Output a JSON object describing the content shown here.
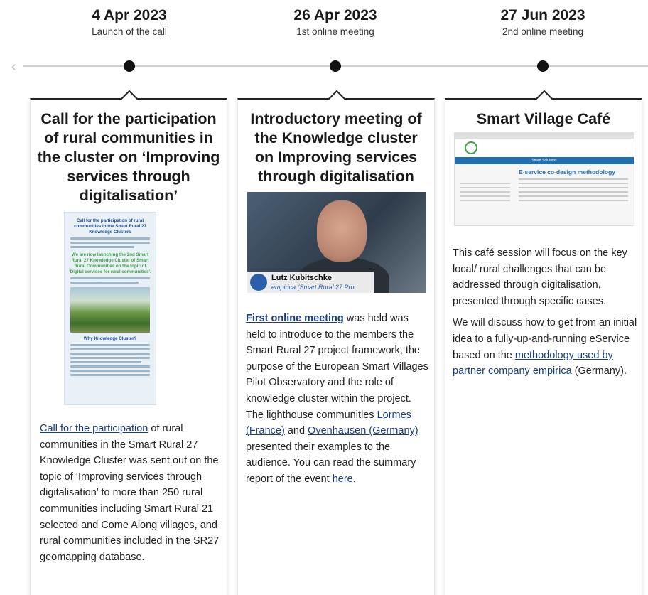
{
  "timeline": {
    "events": [
      {
        "date": "4 Apr 2023",
        "subtitle": "Launch of the call"
      },
      {
        "date": "26 Apr 2023",
        "subtitle": "1st online meeting"
      },
      {
        "date": "27 Jun 2023",
        "subtitle": "2nd online meeting"
      }
    ]
  },
  "cards": {
    "c1": {
      "title": "Call for the participation of rural communities in the cluster on ‘Improving services through digitalisation’",
      "poster": {
        "heading": "Call for the participation of rural communities in the Smart Rural 27 Knowledge Clusters",
        "subheading": "We are now launching the 2nd Smart Rural 27 Knowledge Cluster of Smart Rural Communities on the topic of 'Digital services for rural communities'.",
        "section": "Why Knowledge Cluster?"
      },
      "link": "Call for the participation",
      "text": " of rural communities in the Smart Rural 27 Knowledge Cluster was sent out on the topic of ‘Improving services through digitalisation’ to more than 250 rural communities including Smart Rural 21 selected and Come Along villages, and rural communities included in the SR27 geomapping database."
    },
    "c2": {
      "title": "Introductory meeting of the Knowledge cluster on Improving services through digitalisation",
      "video": {
        "name": "Lutz Kubitschke",
        "org": "empirica (Smart Rural 27 Pro"
      },
      "link1": "First online meeting",
      "text1": " was held was held to introduce to the members the Smart Rural 27 project framework, the purpose of the European Smart Villages Pilot Observatory and the role of knowledge cluster within the project. The lighthouse communities ",
      "link2": "Lormes (France)",
      "text2": " and ",
      "link3": "Ovenhausen (Germany)",
      "text3": " presented their examples to the audience.  You can read the summary report of the event ",
      "link4": "here",
      "text4": "."
    },
    "c3": {
      "title": "Smart Village Café",
      "site": {
        "band": "Smart Solutions",
        "title": "E-service co-design methodology"
      },
      "para1": "This café session will focus on the key local/ rural challenges that can be addressed through digitalisation, presented through specific cases.",
      "para2_text": "We will discuss how to get from an initial idea to a fully-up-and-running eService based on the ",
      "para2_link": "methodology used by partner company empirica",
      "para2_end": " (Germany)."
    }
  }
}
